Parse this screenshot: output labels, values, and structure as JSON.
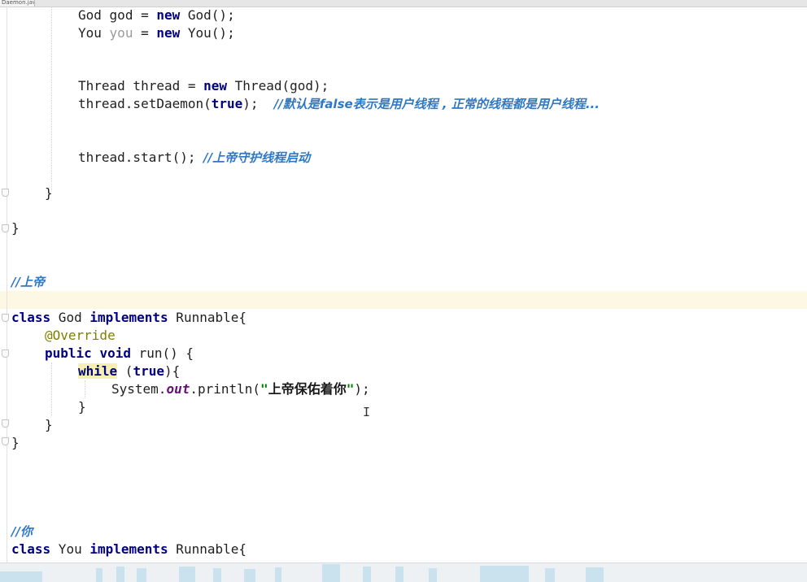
{
  "tab": {
    "label": "Daemon.java"
  },
  "code": {
    "l1": {
      "type": "God",
      "var": "god",
      "eq": " = ",
      "new": "new",
      "ctor": " God();"
    },
    "l2": {
      "type": "You",
      "var": "you",
      "eq": " = ",
      "new": "new",
      "ctor": " You();"
    },
    "l3": {
      "pre": "Thread thread = ",
      "new": "new",
      "post": " Thread(god);"
    },
    "l4": {
      "pre": "thread.setDaemon(",
      "kw": "true",
      "post": ");  ",
      "comment": "//默认是false表示是用户线程 , 正常的线程都是用户线程..."
    },
    "l5": {
      "code": "thread.start(); ",
      "comment": "//上帝守护线程启动"
    },
    "l6": {
      "text": "}"
    },
    "l7": {
      "text": "}"
    },
    "l8": {
      "comment": "//上帝"
    },
    "l9": {
      "kw1": "class",
      "name": " God ",
      "kw2": "implements",
      "rest": " Runnable{"
    },
    "l10": {
      "ann": "@Override"
    },
    "l11": {
      "kw1": "public",
      "sp": " ",
      "kw2": "void",
      "rest": " run() {"
    },
    "l12": {
      "kw": "while",
      "mid": " (",
      "kw2": "true",
      "rest": "){"
    },
    "l13": {
      "pre": "System.",
      "field": "out",
      "mid": ".println(",
      "q1": "\"",
      "str": "上帝保佑着你",
      "q2": "\"",
      "rest": ");"
    },
    "l14": {
      "text": "}"
    },
    "l15": {
      "text": "}"
    },
    "l16": {
      "text": "}"
    },
    "l17": {
      "comment": "//你"
    },
    "l18": {
      "kw1": "class",
      "name": " You ",
      "kw2": "implements",
      "rest": " Runnable{"
    }
  },
  "cursor": {
    "glyph": "I"
  }
}
